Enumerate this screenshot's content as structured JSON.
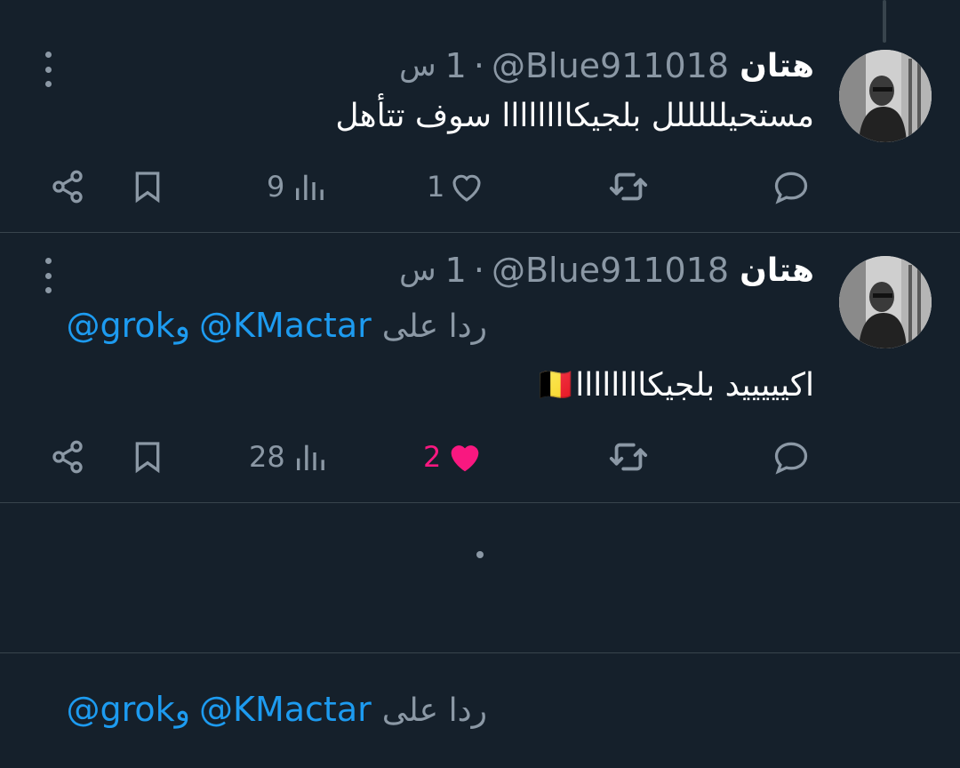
{
  "tweets": [
    {
      "author_name": "هتان",
      "handle": "@Blue911018",
      "separator": "·",
      "time_value": "1",
      "time_unit": "س",
      "text": "مستحيلللللل بلجيكاااااااا سوف تتأهل",
      "views": "9",
      "likes": "1",
      "liked": false
    },
    {
      "author_name": "هتان",
      "handle": "@Blue911018",
      "separator": "·",
      "time_value": "1",
      "time_unit": "س",
      "reply_prefix": "ردا على",
      "reply_mention_1": "@KMactar",
      "reply_conjunction": "و",
      "reply_mention_2": "@grok",
      "text": "اكيييييد بلجيكاااااااا🇧🇪",
      "views": "28",
      "likes": "2",
      "liked": true
    }
  ],
  "composer": {
    "reply_prefix": "ردا على",
    "mention_1": "@KMactar",
    "conjunction": "و",
    "mention_2": "@grok"
  },
  "icons": {
    "more": "more-vertical-icon",
    "reply": "reply-icon",
    "retweet": "retweet-icon",
    "like": "heart-icon",
    "views": "views-chart-icon",
    "bookmark": "bookmark-icon",
    "share": "share-icon"
  },
  "colors": {
    "background": "#15202b",
    "secondary_text": "#8b98a5",
    "link": "#1d9bf0",
    "like_active": "#f91880",
    "divider": "#38444d"
  }
}
